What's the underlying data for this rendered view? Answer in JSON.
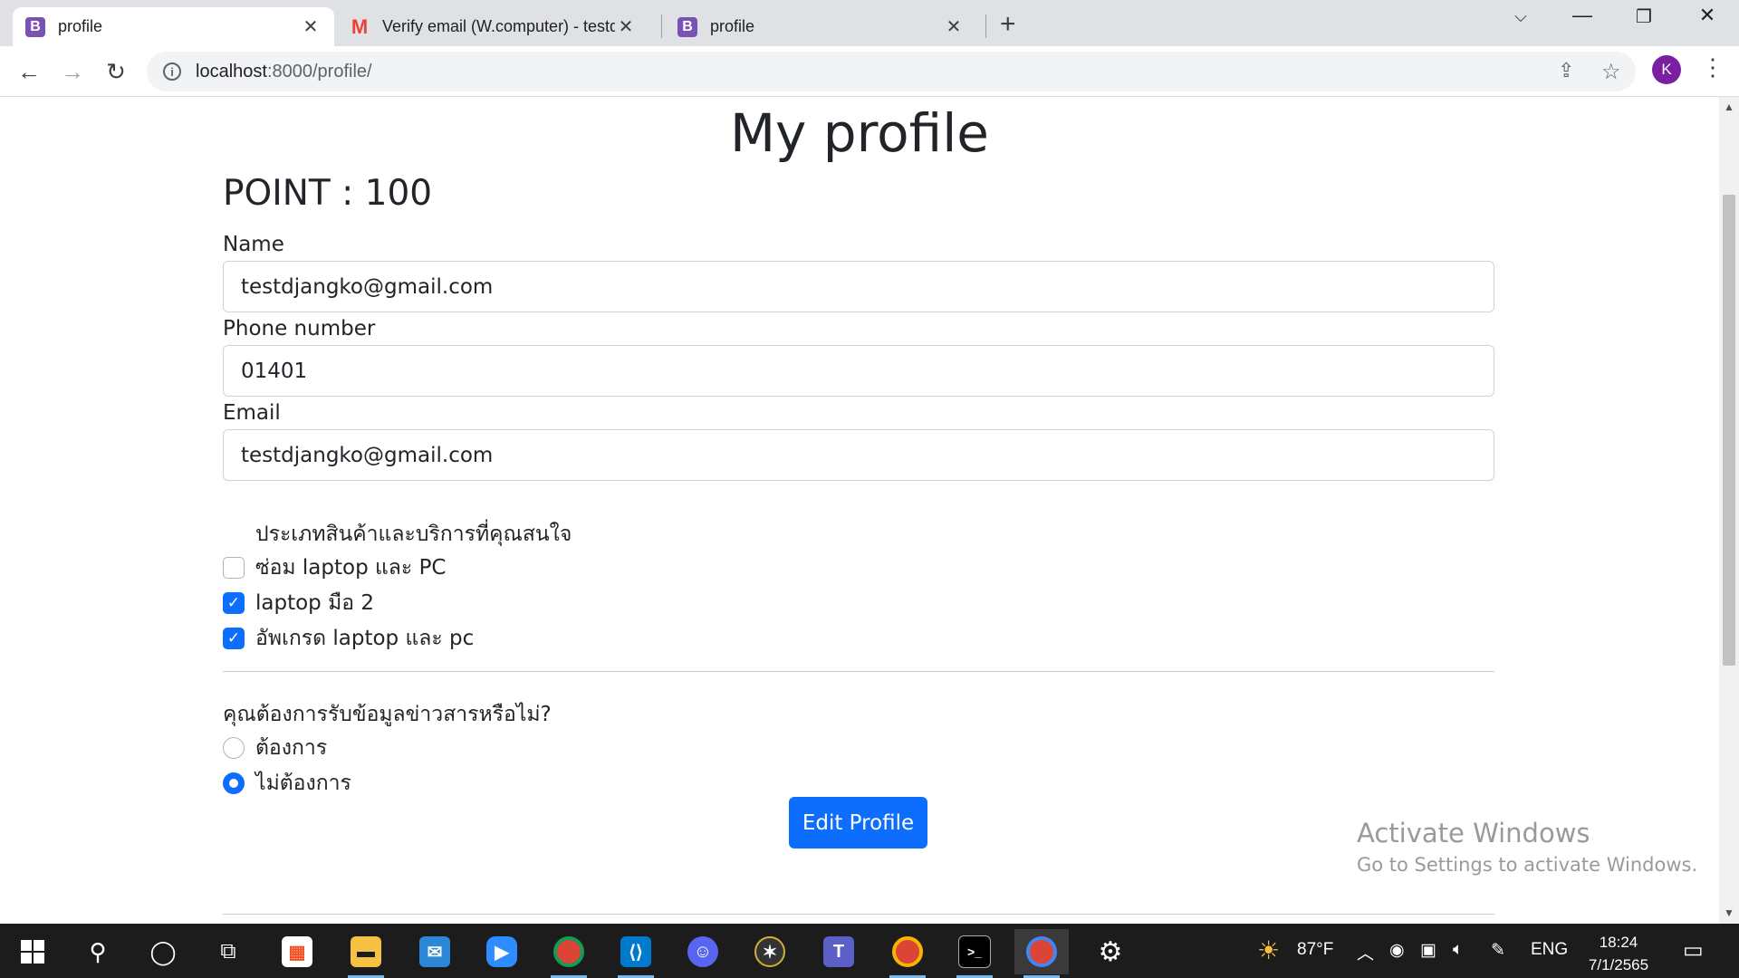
{
  "browser": {
    "tabs": [
      {
        "title": "profile",
        "icon": "bootstrap-icon",
        "active": true
      },
      {
        "title": "Verify email (W.computer) - testd",
        "icon": "gmail-icon",
        "active": false
      },
      {
        "title": "profile",
        "icon": "bootstrap-icon",
        "active": false
      }
    ],
    "address": {
      "host": "localhost",
      "path": ":8000/profile/"
    },
    "profile_initial": "K"
  },
  "page": {
    "title": "My profile",
    "points": "POINT : 100",
    "fields": [
      {
        "label": "Name",
        "value": "testdjangko@gmail.com"
      },
      {
        "label": "Phone number",
        "value": "01401"
      },
      {
        "label": "Email",
        "value": "testdjangko@gmail.com"
      }
    ],
    "interests_heading": "ประเภทสินค้าและบริการที่คุณสนใจ",
    "interests": [
      {
        "label": "ซ่อม laptop และ PC",
        "checked": false
      },
      {
        "label": "laptop มือ 2",
        "checked": true
      },
      {
        "label": "อัพเกรด laptop และ pc",
        "checked": true
      }
    ],
    "news_question": "คุณต้องการรับข้อมูลข่าวสารหรือไม่?",
    "news_options": [
      {
        "label": "ต้องการ",
        "selected": false
      },
      {
        "label": "ไม่ต้องการ",
        "selected": true
      }
    ],
    "edit_button": "Edit Profile"
  },
  "watermark": {
    "line1": "Activate Windows",
    "line2": "Go to Settings to activate Windows."
  },
  "taskbar": {
    "weather_temp": "87°F",
    "language": "ENG",
    "time": "18:24",
    "date": "7/1/2565",
    "apps": [
      "file-explorer-icon",
      "mail-icon",
      "zoom-icon",
      "chrome-icon",
      "vscode-icon",
      "discord-icon",
      "app-icon",
      "teams-icon",
      "chrome-icon",
      "terminal-icon",
      "chrome-icon",
      "settings-icon"
    ]
  },
  "colors": {
    "primary": "#0d6efd",
    "bootstrap_purple": "#7952b3",
    "taskbar": "#1c1c1c"
  }
}
